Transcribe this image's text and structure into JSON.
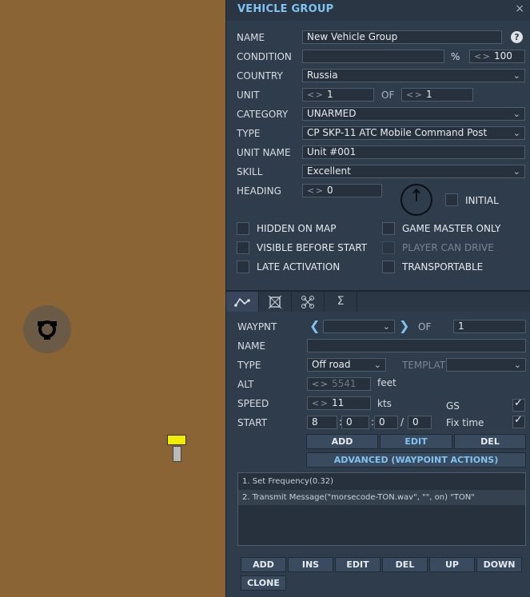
{
  "panel": {
    "title": "VEHICLE GROUP",
    "close": "×",
    "name_label": "NAME",
    "name_value": "New Vehicle Group",
    "help": "?",
    "condition_label": "CONDITION",
    "condition_percent": "%",
    "condition_value": "100",
    "country_label": "COUNTRY",
    "country_value": "Russia",
    "unit_label": "UNIT",
    "unit_value": "1",
    "unit_of": "OF",
    "unit_total": "1",
    "category_label": "CATEGORY",
    "category_value": "UNARMED",
    "type_label": "TYPE",
    "type_value": "CP SKP-11 ATC Mobile Command Post",
    "unit_name_label": "UNIT NAME",
    "unit_name_value": "Unit #001",
    "skill_label": "SKILL",
    "skill_value": "Excellent",
    "heading_label": "HEADING",
    "heading_value": "0",
    "initial_label": "INITIAL",
    "checks": {
      "hidden_on_map": "HIDDEN ON MAP",
      "visible_before_start": "VISIBLE BEFORE START",
      "late_activation": "LATE ACTIVATION",
      "game_master_only": "GAME MASTER ONLY",
      "player_can_drive": "PLAYER CAN DRIVE",
      "transportable": "TRANSPORTABLE"
    }
  },
  "tabs": {
    "route_icon": "route-icon",
    "target_icon": "target-icon",
    "group_icon": "group-icon",
    "summary_icon": "Σ"
  },
  "waypoint": {
    "waypnt_label": "WAYPNT",
    "of_label": "OF",
    "of_value": "1",
    "name_label": "NAME",
    "type_label": "TYPE",
    "type_value": "Off road",
    "template_label": "TEMPLATE",
    "alt_label": "ALT",
    "alt_value": "5541",
    "alt_unit": "feet",
    "speed_label": "SPEED",
    "speed_value": "11",
    "speed_unit": "kts",
    "gs_label": "GS",
    "start_label": "START",
    "start_day": "8",
    "start_h": "0",
    "start_m": "0",
    "start_s": "0",
    "sep_colon": ":",
    "sep_slash": "/",
    "fix_time_label": "Fix time",
    "add": "ADD",
    "edit": "EDIT",
    "del": "DEL",
    "advanced": "ADVANCED (WAYPOINT ACTIONS)"
  },
  "actions": {
    "items": [
      "1. Set Frequency(0.32)",
      "2. Transmit Message(\"morsecode-TON.wav\", \"\", on) \"TON\""
    ],
    "add": "ADD",
    "ins": "INS",
    "edit": "EDIT",
    "del": "DEL",
    "up": "UP",
    "down": "DOWN",
    "clone": "CLONE"
  },
  "colors": {
    "map_ground": "#8a6434",
    "panel_bg": "#2f3c4b",
    "accent": "#7ec3f1",
    "unit_marker": "#f2ee00"
  }
}
